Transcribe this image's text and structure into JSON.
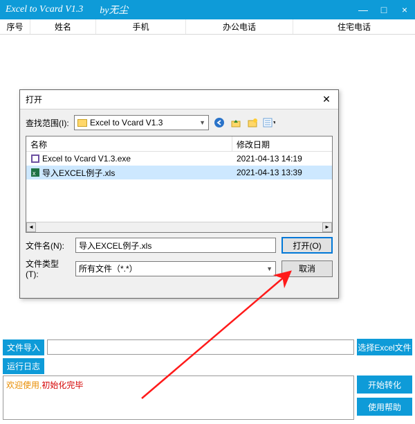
{
  "titlebar": {
    "app_title": "Excel to Vcard V1.3",
    "by": "by无尘"
  },
  "columns": {
    "序号": "序号",
    "姓名": "姓名",
    "手机": "手机",
    "办公电话": "办公电话",
    "住宅电话": "住宅电话"
  },
  "file_import": {
    "label": "文件导入",
    "value": "",
    "select_button": "选择Excel文件"
  },
  "runlog": {
    "label": "运行日志",
    "msg_welcome": "欢迎使用,",
    "msg_init": "初始化完毕"
  },
  "side_buttons": {
    "start": "开始转化",
    "help": "使用帮助"
  },
  "dialog": {
    "title": "打开",
    "lookin_label": "查找范围(I):",
    "lookin_value": "Excel to Vcard V1.3",
    "col_name": "名称",
    "col_date": "修改日期",
    "rows": [
      {
        "name": "Excel to Vcard V1.3.exe",
        "date": "2021-04-13 14:19"
      },
      {
        "name": "导入EXCEL例子.xls",
        "date": "2021-04-13 13:39"
      }
    ],
    "filename_label": "文件名(N):",
    "filename_value": "导入EXCEL例子.xls",
    "filetype_label": "文件类型(T):",
    "filetype_value": "所有文件（*.*）",
    "open_btn": "打开(O)",
    "cancel_btn": "取消"
  }
}
